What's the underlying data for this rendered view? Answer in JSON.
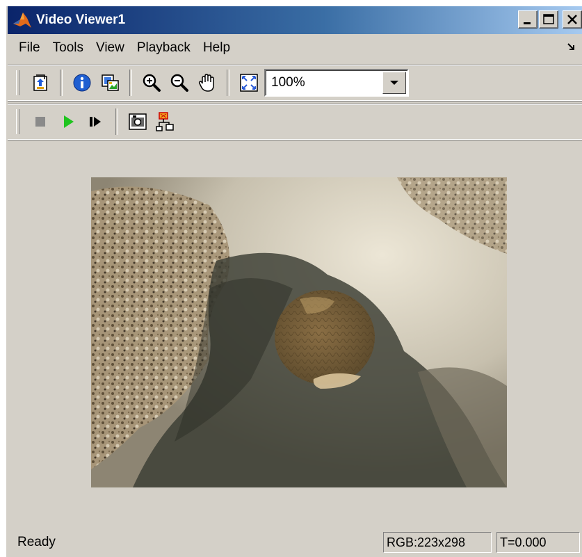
{
  "window": {
    "title": "Video Viewer1",
    "controls": [
      "minimize-icon",
      "maximize-icon",
      "close-icon"
    ]
  },
  "menubar": {
    "items": [
      {
        "label": "File"
      },
      {
        "label": "Tools"
      },
      {
        "label": "View"
      },
      {
        "label": "Playback"
      },
      {
        "label": "Help"
      }
    ],
    "dock_icon": "dock-arrow-icon"
  },
  "toolbar": {
    "buttons": [
      {
        "icon": "new-window-icon"
      },
      {
        "icon": "info-icon"
      },
      {
        "icon": "video-info-icon"
      },
      {
        "icon": "zoom-in-icon"
      },
      {
        "icon": "zoom-out-icon"
      },
      {
        "icon": "pan-hand-icon"
      },
      {
        "icon": "fit-to-window-icon"
      }
    ],
    "zoom": {
      "value": "100%"
    }
  },
  "playback_toolbar": {
    "buttons": [
      {
        "icon": "stop-icon"
      },
      {
        "icon": "play-icon"
      },
      {
        "icon": "step-forward-icon"
      },
      {
        "icon": "snapshot-camera-icon"
      },
      {
        "icon": "highlight-block-icon"
      }
    ]
  },
  "colors": {
    "window_bg": "#d4d0c8",
    "title_bar_start": "#0a246a",
    "title_bar_end": "#a6caf0",
    "play_green": "#1fc41f"
  },
  "status": {
    "text": "Ready",
    "image_info": "RGB:223x298",
    "time": "T=0.000"
  }
}
